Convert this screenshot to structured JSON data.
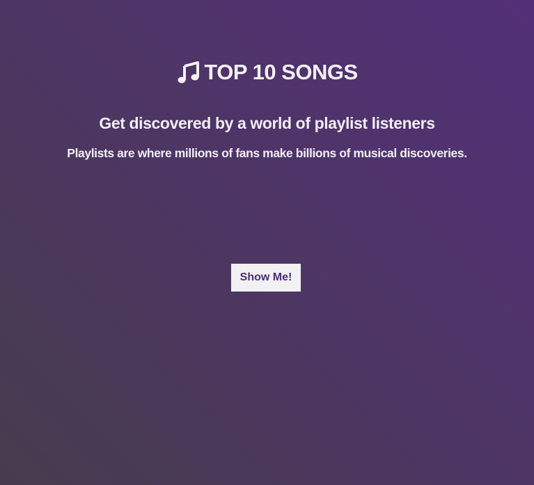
{
  "brand": {
    "icon": "music-note-icon",
    "title": "TOP 10 SONGS"
  },
  "hero": {
    "headline": "Get discovered by a world of playlist listeners",
    "subline": "Playlists are where millions of fans make billions of musical discoveries."
  },
  "cta": {
    "label": "Show Me!"
  },
  "colors": {
    "background_top_right": "#532f78",
    "background_bottom_left": "#473c4e",
    "button_bg": "#f1f0f2",
    "button_text": "#4e2d72",
    "text": "#f1eef4"
  }
}
